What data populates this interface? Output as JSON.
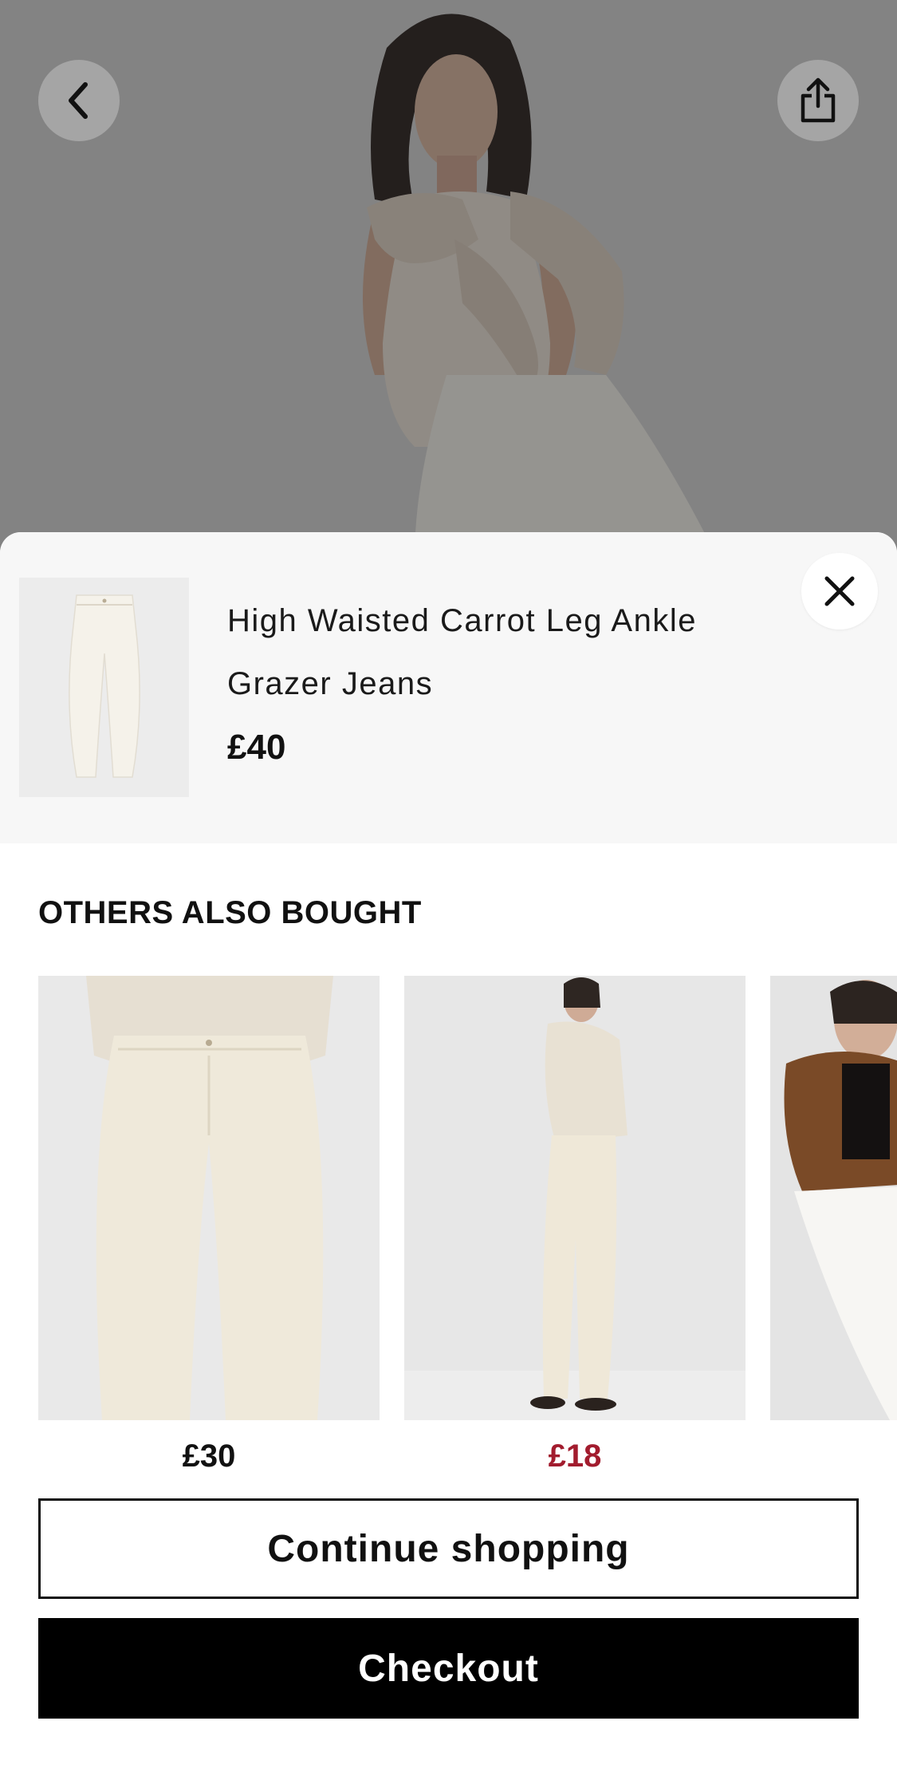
{
  "hero": {
    "back_icon": "chevron-left-icon",
    "share_icon": "share-icon"
  },
  "added_item": {
    "title": "High Waisted Carrot Leg Ankle Grazer Jeans",
    "price": "£40",
    "close_icon": "close-icon"
  },
  "recommendations": {
    "heading": "OTHERS ALSO BOUGHT",
    "items": [
      {
        "price": "£30",
        "price_color": "#111111"
      },
      {
        "price": "£18",
        "price_color": "#a21c2e"
      },
      {
        "price": "",
        "price_color": "#111111"
      }
    ]
  },
  "actions": {
    "continue_label": "Continue shopping",
    "checkout_label": "Checkout"
  },
  "colors": {
    "sale_price": "#a21c2e",
    "checkout_bg": "#000000",
    "panel_bg": "#f7f7f7"
  }
}
